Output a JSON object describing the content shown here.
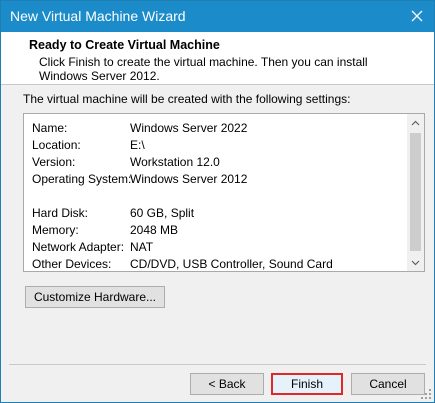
{
  "window": {
    "title": "New Virtual Machine Wizard"
  },
  "header": {
    "title": "Ready to Create Virtual Machine",
    "description": "Click Finish to create the virtual machine. Then you can install Windows Server 2012."
  },
  "intro_text": "The virtual machine will be created with the following settings:",
  "settings": [
    {
      "label": "Name:",
      "value": "Windows Server 2022"
    },
    {
      "label": "Location:",
      "value": "E:\\"
    },
    {
      "label": "Version:",
      "value": "Workstation 12.0"
    },
    {
      "label": "Operating System:",
      "value": "Windows Server 2012"
    },
    {
      "label": "Hard Disk:",
      "value": "60 GB, Split"
    },
    {
      "label": "Memory:",
      "value": "2048 MB"
    },
    {
      "label": "Network Adapter:",
      "value": "NAT"
    },
    {
      "label": "Other Devices:",
      "value": "CD/DVD, USB Controller, Sound Card"
    }
  ],
  "buttons": {
    "customize": "Customize Hardware...",
    "back": "< Back",
    "finish": "Finish",
    "cancel": "Cancel"
  },
  "icons": {
    "close": "close-icon",
    "scroll_up": "chevron-up-icon",
    "scroll_down": "chevron-down-icon"
  },
  "colors": {
    "titlebar": "#1b8cc9",
    "highlight": "#e02828"
  }
}
